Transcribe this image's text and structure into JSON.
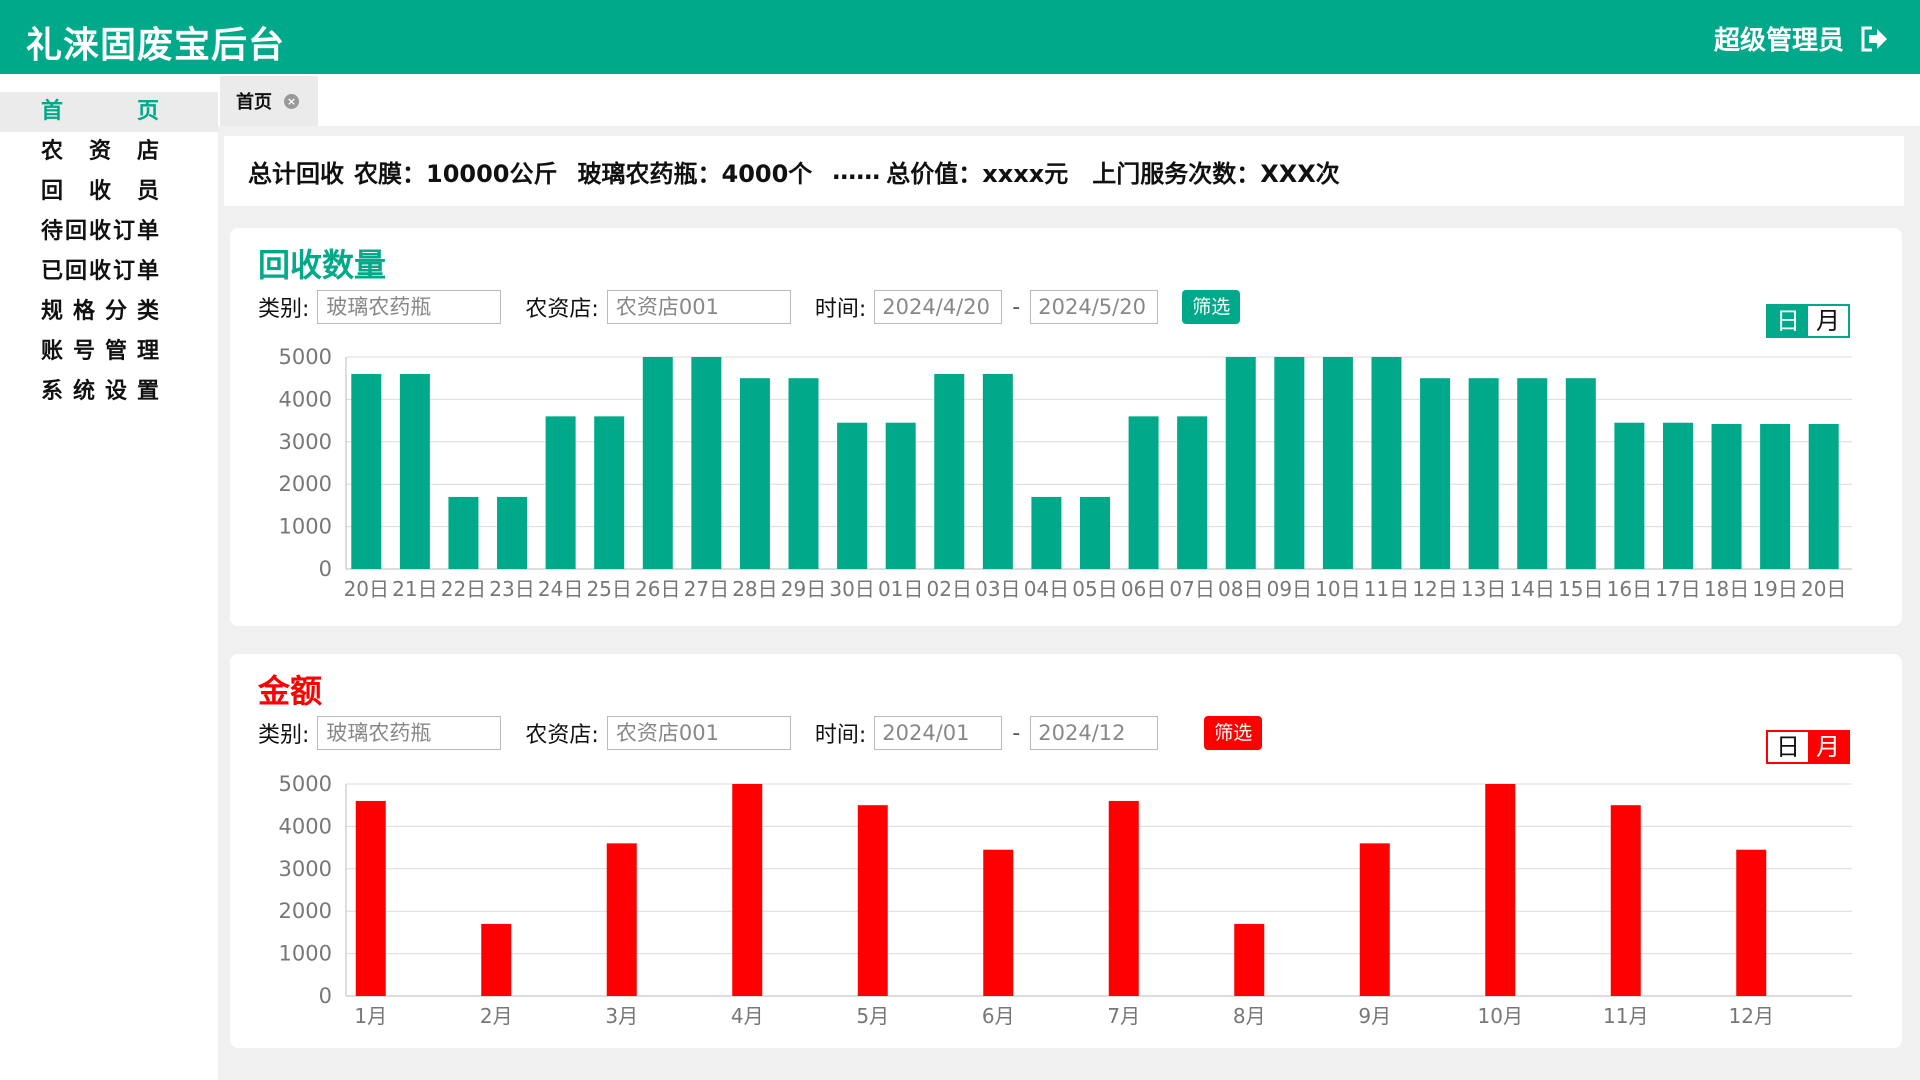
{
  "header": {
    "app_title": "礼涞固废宝后台",
    "user_name": "超级管理员",
    "logout_icon": "logout-icon"
  },
  "sidebar": {
    "items": [
      {
        "label": "首　　页",
        "active": true
      },
      {
        "label": "农 资 店",
        "active": false
      },
      {
        "label": "回 收 员",
        "active": false
      },
      {
        "label": "待回收订单",
        "active": false
      },
      {
        "label": "已回收订单",
        "active": false
      },
      {
        "label": "规格分类",
        "active": false
      },
      {
        "label": "账号管理",
        "active": false
      },
      {
        "label": "系统设置",
        "active": false
      }
    ]
  },
  "tabs": [
    {
      "label": "首页",
      "close_icon": "close-icon"
    }
  ],
  "summary": {
    "total_label": "总计回收",
    "film": "农膜：10000公斤",
    "bottle": "玻璃农药瓶：4000个",
    "ellipsis": "……",
    "value": "总价值：xxxx元",
    "visits": "上门服务次数：XXX次"
  },
  "quantity": {
    "title": "回收数量",
    "category_label": "类别:",
    "category_placeholder": "玻璃农药瓶",
    "store_label": "农资店:",
    "store_placeholder": "农资店001",
    "time_label": "时间:",
    "date_from": "2024/4/20",
    "date_to": "2024/5/20",
    "dash": "-",
    "filter_label": "筛选",
    "toggle_day": "日",
    "toggle_month": "月",
    "active_toggle": "日",
    "color": "#00a98a"
  },
  "amount": {
    "title": "金额",
    "category_label": "类别:",
    "category_placeholder": "玻璃农药瓶",
    "store_label": "农资店:",
    "store_placeholder": "农资店001",
    "time_label": "时间:",
    "date_from": "2024/01",
    "date_to": "2024/12",
    "dash": "-",
    "filter_label": "筛选",
    "toggle_day": "日",
    "toggle_month": "月",
    "active_toggle": "月",
    "color": "#ff0000"
  },
  "chart_data": [
    {
      "type": "bar",
      "title": "回收数量",
      "categories": [
        "20日",
        "21日",
        "22日",
        "23日",
        "24日",
        "25日",
        "26日",
        "27日",
        "28日",
        "29日",
        "30日",
        "01日",
        "02日",
        "03日",
        "04日",
        "05日",
        "06日",
        "07日",
        "08日",
        "09日",
        "10日",
        "11日",
        "12日",
        "13日",
        "14日",
        "15日",
        "16日",
        "17日",
        "18日",
        "19日",
        "20日"
      ],
      "values": [
        4600,
        4600,
        1700,
        1700,
        3600,
        3600,
        5000,
        5000,
        4500,
        4500,
        3450,
        3450,
        4600,
        4600,
        1700,
        1700,
        3600,
        3600,
        5000,
        5000,
        5000,
        5000,
        4500,
        4500,
        4500,
        4500,
        3450,
        3450,
        3420,
        3420,
        3420
      ],
      "yticks": [
        0,
        1000,
        2000,
        3000,
        4000,
        5000
      ],
      "ylim": [
        0,
        5000
      ],
      "grid": true,
      "color": "#00a98a"
    },
    {
      "type": "bar",
      "title": "金额",
      "categories": [
        "1月",
        "2月",
        "3月",
        "4月",
        "5月",
        "6月",
        "7月",
        "8月",
        "9月",
        "10月",
        "11月",
        "12月"
      ],
      "values": [
        4600,
        1700,
        3600,
        5000,
        4500,
        3450,
        4600,
        1700,
        3600,
        5000,
        4500,
        3450
      ],
      "yticks": [
        0,
        1000,
        2000,
        3000,
        4000,
        5000
      ],
      "ylim": [
        0,
        5000
      ],
      "grid": true,
      "color": "#ff0000"
    }
  ]
}
